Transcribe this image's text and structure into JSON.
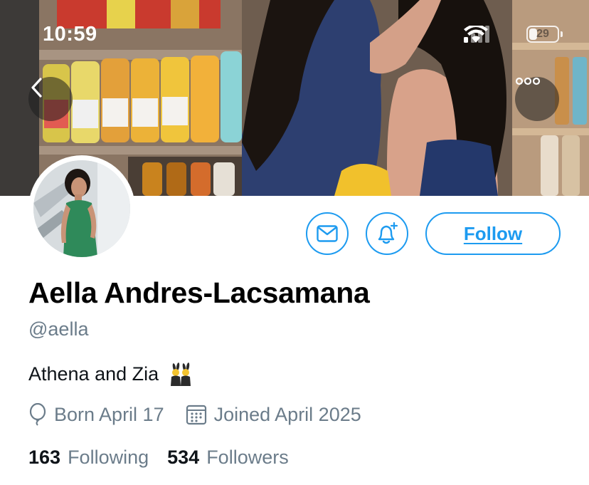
{
  "status_bar": {
    "time": "10:59",
    "battery": "29",
    "battery_level": 0.29
  },
  "profile": {
    "display_name": "Aella Andres-Lacsamana",
    "handle": "@aella",
    "bio": "Athena and Zia",
    "bio_emoji": "people-with-bunny-ears",
    "birthday": "Born April 17",
    "joined": "Joined April 2025",
    "following_count": "163",
    "following_label": "Following",
    "followers_count": "534",
    "followers_label": "Followers"
  },
  "actions": {
    "follow_label": "Follow",
    "message_icon": "envelope-icon",
    "notify_icon": "bell-plus-icon"
  },
  "colors": {
    "accent": "#1d9bf0",
    "secondary_text": "#6b7c8a",
    "primary_text": "#0f1419"
  }
}
